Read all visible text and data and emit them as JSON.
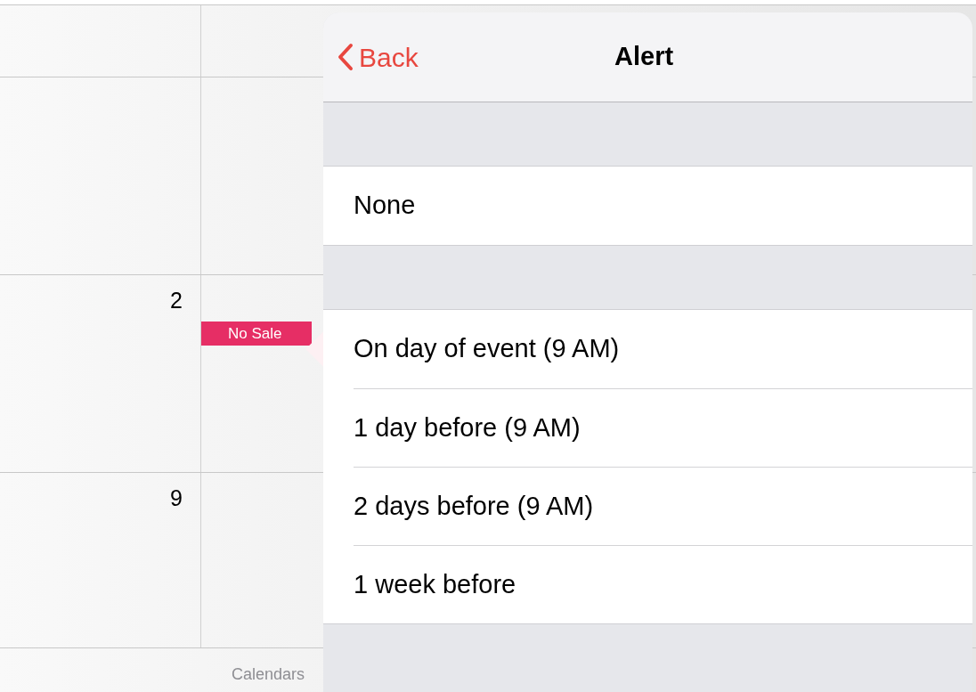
{
  "calendar": {
    "weeks": [
      {
        "day": "2",
        "events": [
          {
            "title": "No Sale",
            "color": "#e62e65"
          }
        ]
      },
      {
        "day": "9"
      }
    ],
    "toolbar": {
      "label": "Calendars"
    }
  },
  "popover": {
    "back": "Back",
    "title": "Alert",
    "sections": [
      [
        {
          "label": "None"
        }
      ],
      [
        {
          "label": "On day of event (9 AM)"
        },
        {
          "label": "1 day before (9 AM)"
        },
        {
          "label": "2 days before (9 AM)"
        },
        {
          "label": "1 week before"
        }
      ]
    ]
  }
}
